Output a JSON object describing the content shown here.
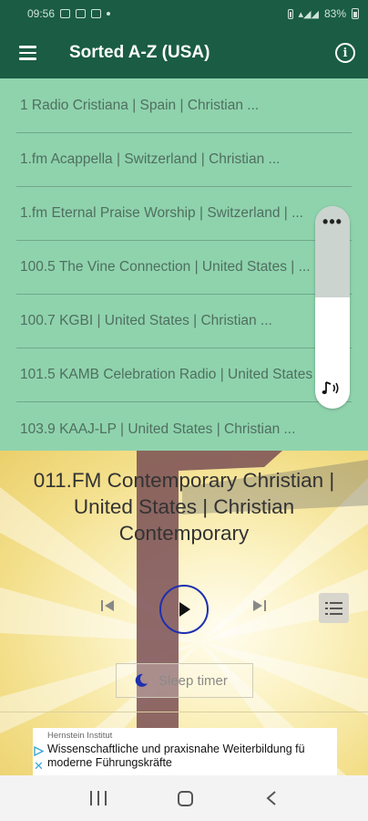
{
  "status_bar": {
    "time": "09:56",
    "battery": "83%"
  },
  "app_bar": {
    "title": "Sorted A-Z (USA)",
    "menu_icon": "hamburger-menu-icon",
    "info_icon": "info-icon"
  },
  "stations": [
    "1 Radio Cristiana | Spain | Christian ...",
    "1.fm Acappella | Switzerland | Christian ...",
    "1.fm Eternal Praise Worship | Switzerland | ...",
    "100.5 The Vine Connection | United States | ...",
    "100.7 KGBI | United States | Christian ...",
    "101.5 KAMB Celebration Radio | United States ...",
    "103.9 KAAJ-LP | United States | Christian ..."
  ],
  "volume_panel": {
    "more_icon": "more-horizontal-icon",
    "music_icon": "music-volume-icon",
    "level": 0.55
  },
  "player": {
    "now_playing": "011.FM Contemporary Christian | United States | Christian Contemporary",
    "sleep_timer_label": "Sleep timer",
    "prev_icon": "skip-previous-icon",
    "play_icon": "play-icon",
    "next_icon": "skip-next-icon",
    "queue_icon": "queue-list-icon"
  },
  "ad": {
    "sponsor": "Hernstein Institut",
    "text": "Wissenschaftliche und praxisnahe Weiterbildung fü moderne Führungskräfte"
  },
  "colors": {
    "app_bar": "#1a5c44",
    "list_bg": "#8fd3ad",
    "play_ring": "#1e2fb0",
    "moon": "#1e2fb0"
  }
}
